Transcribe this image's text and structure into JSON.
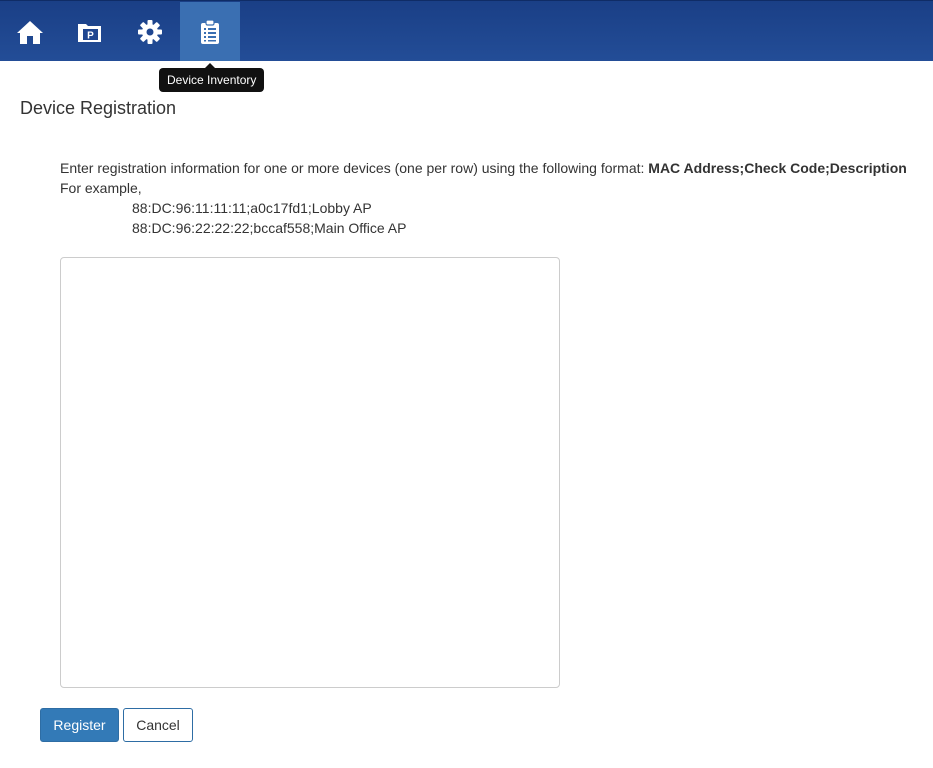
{
  "nav": {
    "items": [
      {
        "name": "home-icon",
        "active": false
      },
      {
        "name": "parking-icon",
        "active": false
      },
      {
        "name": "gear-icon",
        "active": false
      },
      {
        "name": "clipboard-icon",
        "active": true
      }
    ],
    "tooltip": "Device Inventory"
  },
  "page": {
    "title": "Device Registration",
    "instruction_text": "Enter registration information for one or more devices (one per row) using the following format: ",
    "format_text": "MAC Address;Check Code;Description",
    "example_label": "For example,",
    "examples": [
      "88:DC:96:11:11:11;a0c17fd1;Lobby AP",
      "88:DC:96:22:22:22;bccaf558;Main Office AP"
    ],
    "textarea_value": ""
  },
  "actions": {
    "register_label": "Register",
    "cancel_label": "Cancel"
  },
  "colors": {
    "topbar": "#1f4690",
    "active_nav": "#3a6fb2",
    "primary_button": "#337ab7"
  }
}
